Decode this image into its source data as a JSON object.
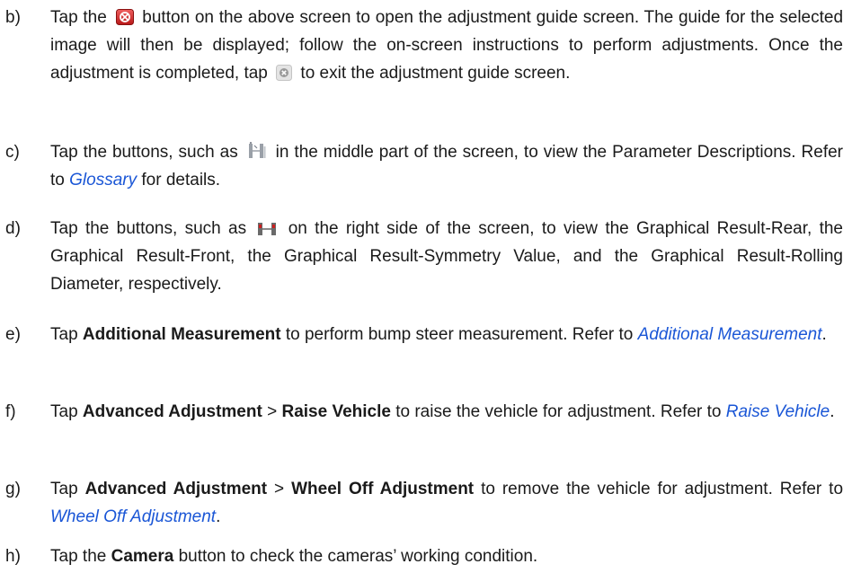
{
  "items": [
    {
      "marker": "b)",
      "t1": "Tap the",
      "icon1": "red-adjust-guide-icon",
      "t2": "button on the above screen to open the adjustment guide screen. The guide for the selected image will then be displayed; follow the on-screen instructions to perform adjustments. Once the adjustment is completed, tap",
      "icon2": "close-x-icon",
      "t3": "to exit the adjustment guide screen."
    },
    {
      "marker": "c)",
      "t1": "Tap the buttons, such as",
      "icon1": "parameter-wheel-icon",
      "t2": "in the middle part of the screen, to view the Parameter Descriptions. Refer to",
      "link": "Glossary",
      "t3": "for details."
    },
    {
      "marker": "d)",
      "t1": "Tap the buttons, such as",
      "icon1": "graph-axle-icon",
      "t2": "on the right side of the screen, to view the Graphical Result-Rear, the Graphical Result-Front, the Graphical Result-Symmetry Value, and the Graphical Result-Rolling Diameter, respectively."
    },
    {
      "marker": "e)",
      "t1": "Tap",
      "b1": "Additional Measurement",
      "t2": "to perform bump steer measurement. Refer to",
      "link": "Additional Measurement",
      "t3": "."
    },
    {
      "marker": "f)",
      "t1": "Tap",
      "b1": "Advanced Adjustment",
      "t2": ">",
      "b2": "Raise Vehicle",
      "t3": "to raise the vehicle for adjustment. Refer to",
      "link": "Raise Vehicle",
      "t4": "."
    },
    {
      "marker": "g)",
      "t1": "Tap",
      "b1": "Advanced Adjustment",
      "t2": ">",
      "b2": "Wheel Off Adjustment",
      "t3": "to remove the vehicle for adjustment. Refer to",
      "link": "Wheel Off Adjustment",
      "t4": "."
    },
    {
      "marker": "h)",
      "t1": "Tap the",
      "b1": "Camera",
      "t2": "button to check the cameras’ working condition."
    }
  ]
}
